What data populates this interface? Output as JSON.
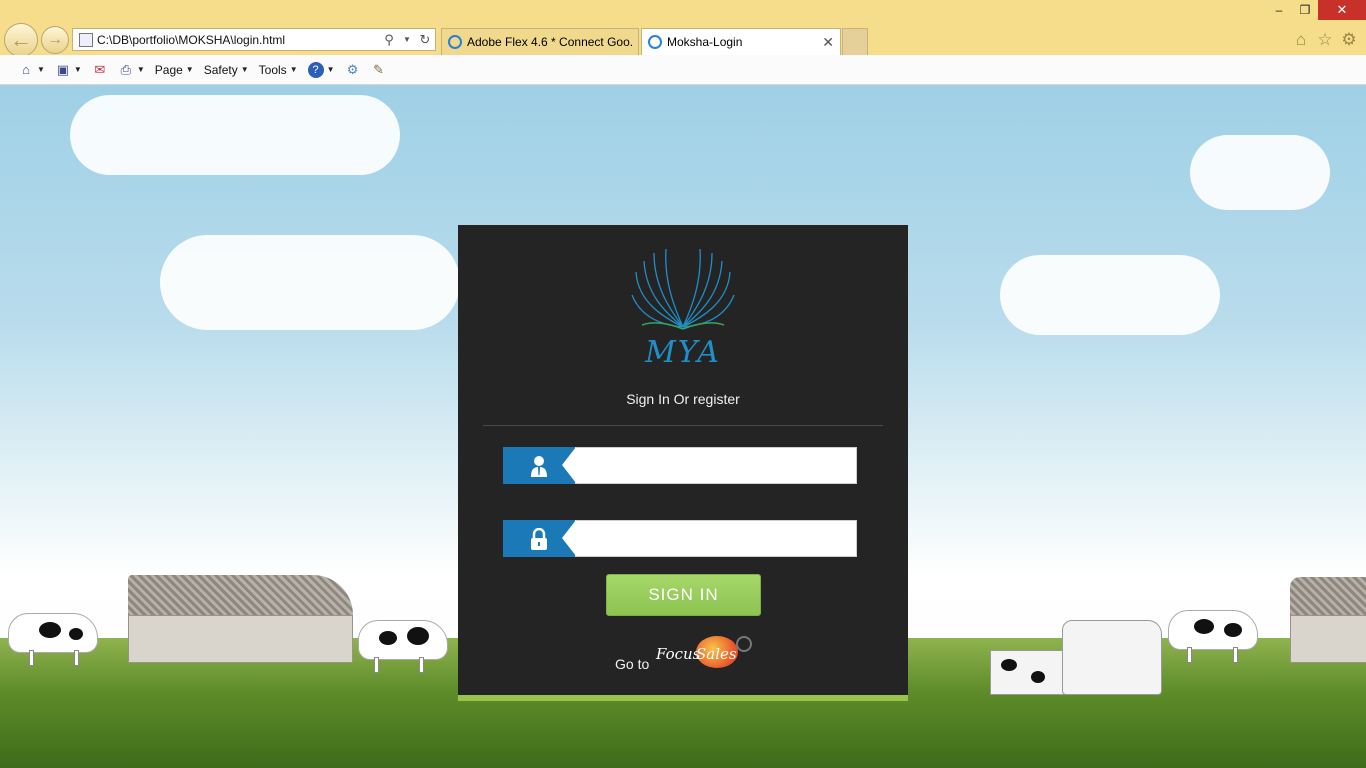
{
  "browser": {
    "address": "C:\\DB\\portfolio\\MOKSHA\\login.html",
    "tabs": [
      {
        "label": "Adobe Flex 4.6 * Connect Goo..."
      },
      {
        "label": "Moksha-Login"
      }
    ],
    "window_controls": {
      "minimize": "–",
      "maximize": "❐",
      "close": "✕"
    },
    "command_bar": {
      "page": "Page",
      "safety": "Safety",
      "tools": "Tools"
    }
  },
  "login": {
    "logo_text": "MYA",
    "heading": "Sign In Or register",
    "username_value": "",
    "password_value": "",
    "signin_label": "SIGN IN",
    "goto_label": "Go to",
    "focus_brand_a": "Focus",
    "focus_brand_b": "Sales"
  },
  "colors": {
    "panel_bg": "#242424",
    "accent_green": "#98c44e",
    "icon_blue": "#1b79b8",
    "sky": "#9fd0e6"
  },
  "icons": [
    "back-icon",
    "forward-icon",
    "search-icon",
    "refresh-icon",
    "home-icon",
    "star-icon",
    "gear-icon",
    "feeds-icon",
    "mail-icon",
    "print-icon",
    "help-icon",
    "user-icon",
    "lock-icon"
  ]
}
